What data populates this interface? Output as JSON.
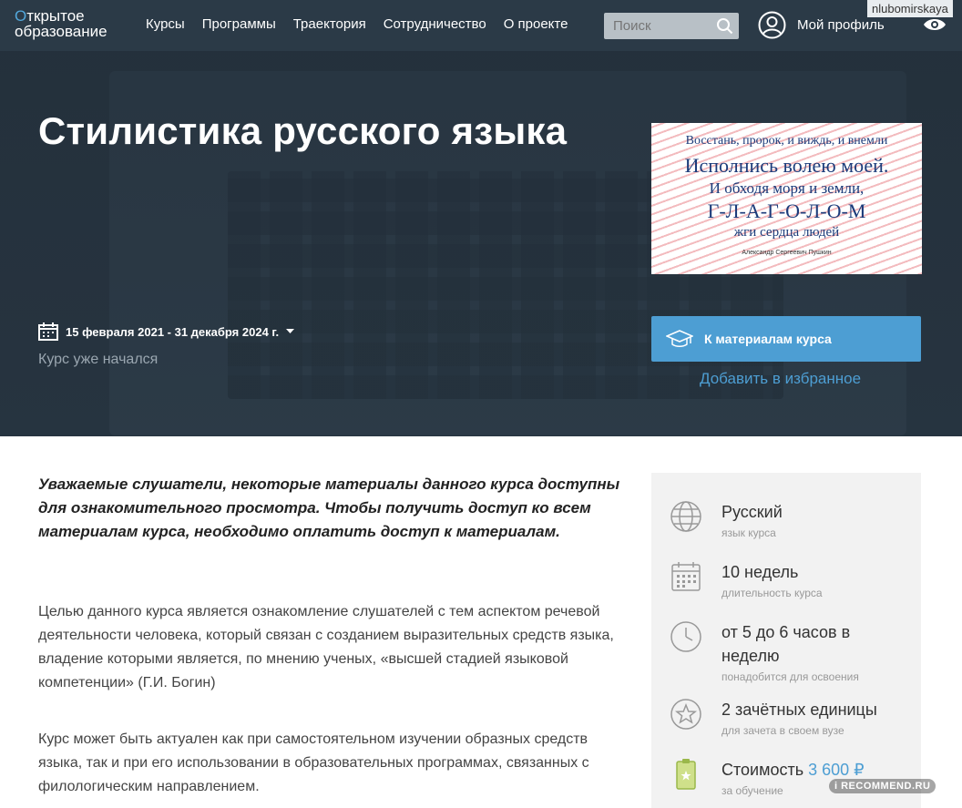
{
  "header": {
    "logo_line1": "ткрытое",
    "logo_o": "О",
    "logo_line2": "образование",
    "nav": [
      "Курсы",
      "Программы",
      "Траектория",
      "Сотрудничество",
      "О проекте"
    ],
    "search_placeholder": "Поиск",
    "profile_label": "Мой профиль",
    "username": "nlubomirskaya"
  },
  "course": {
    "title": "Стилистика русского языка",
    "dates": "15 февраля 2021 - 31 декабря 2024 г.",
    "status": "Курс уже начался",
    "materials_button": "К материалам курса",
    "favorite_link": "Добавить в избранное",
    "cover": {
      "line1": "Восстань, пророк, и виждь, и внемли",
      "line2": "Исполнись волею моей.",
      "line3": "И обходя моря и земли,",
      "line4": "Г-Л-А-Г-О-Л-О-М",
      "line5": "жги сердца людей",
      "author": "Александр Сергеевич Пушкин"
    }
  },
  "content": {
    "intro": "Уважаемые слушатели, некоторые материалы данного курса доступны для ознакомительного просмотра. Чтобы получить доступ ко всем материалам курса, необходимо оплатить доступ к материалам.",
    "p1": "Целью данного курса является ознакомление слушателей с тем аспектом речевой деятельности человека, который связан с созданием выразительных средств языка, владение которыми является, по мнению ученых, «высшей стадией языковой компетенции» (Г.И. Богин)",
    "p2": "Курс может быть актуален как при самостоятельном изучении образных средств языка, так и  при его использовании в образовательных программах, связанных с филологическим направлением."
  },
  "sidebar": {
    "language": {
      "value": "Русский",
      "label": "язык курса",
      "icon": "globe-icon"
    },
    "duration": {
      "value": "10 недель",
      "label": "длительность курса",
      "icon": "calendar-icon"
    },
    "effort": {
      "value": "от 5 до 6 часов в неделю",
      "label": "понадобится для освоения",
      "icon": "clock-icon"
    },
    "credits": {
      "value": "2 зачётных единицы",
      "label": "для зачета в своем вузе",
      "icon": "star-icon"
    },
    "cost": {
      "prefix": "Стоимость",
      "price": "3 600 ₽",
      "label": "за обучение",
      "icon": "price-tag-icon"
    }
  },
  "watermark": "i RECOMMEND.RU",
  "colors": {
    "accent": "#4d9ed3",
    "header_bg": "#2b3a47",
    "sidebar_bg": "#f2f2f2"
  }
}
